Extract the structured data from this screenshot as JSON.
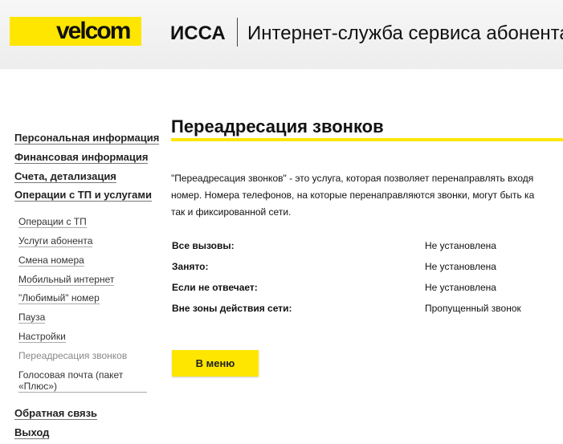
{
  "header": {
    "logo_text": "velcom",
    "brand": "ИССА",
    "service_title": "Интернет-служба сервиса абонента"
  },
  "sidebar": {
    "main_items": [
      {
        "label": "Персональная информация"
      },
      {
        "label": "Финансовая информация"
      },
      {
        "label": "Счета, детализация"
      },
      {
        "label": "Операции с ТП и услугами"
      }
    ],
    "sub_items": [
      {
        "label": "Операции с ТП"
      },
      {
        "label": "Услуги абонента"
      },
      {
        "label": "Смена номера"
      },
      {
        "label": "Мобильный интернет"
      },
      {
        "label": "\"Любимый\" номер"
      },
      {
        "label": "Пауза"
      },
      {
        "label": "Настройки"
      },
      {
        "label": "Переадресация звонков",
        "active": true
      },
      {
        "label": "Голосовая почта (пакет «Плюс»)"
      }
    ],
    "bottom_items": [
      {
        "label": "Обратная связь"
      },
      {
        "label": "Выход"
      }
    ]
  },
  "main": {
    "title": "Переадресация звонков",
    "description_lines": [
      "\"Переадресация звонков\" - это услуга, которая позволяет перенаправлять входя",
      "номер. Номера телефонов, на которые перенаправляются звонки, могут быть ка",
      "так и фиксированной сети."
    ],
    "forwarding_rows": [
      {
        "label": "Все вызовы:",
        "value": "Не установлена"
      },
      {
        "label": "Занято:",
        "value": "Не установлена"
      },
      {
        "label": "Если не отвечает:",
        "value": "Не установлена"
      },
      {
        "label": "Вне зоны действия сети:",
        "value": "Пропущенный звонок"
      }
    ],
    "menu_button": "В меню"
  },
  "colors": {
    "brand_yellow": "#ffe600",
    "header_bg": "#f0f0f0",
    "active_nav": "#888888"
  }
}
